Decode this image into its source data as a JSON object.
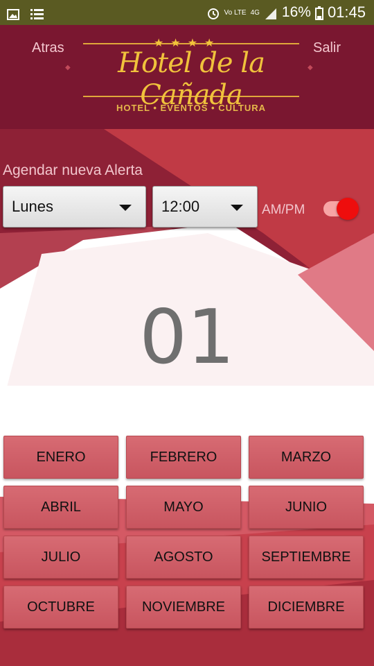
{
  "status_bar": {
    "battery": "16%",
    "time": "01:45",
    "network": "4G",
    "volte": "Vo LTE",
    "icons": [
      "image-icon",
      "list-icon",
      "alarm-icon",
      "signal-icon",
      "battery-icon"
    ]
  },
  "header": {
    "back_label": "Atras",
    "exit_label": "Salir",
    "logo_title": "Hotel de la Cañada",
    "logo_stars": "★★★★",
    "logo_subtitle": "HOTEL • EVENTOS • CULTURA"
  },
  "alert": {
    "title": "Agendar nueva Alerta",
    "day_value": "Lunes",
    "time_value": "12:00",
    "ampm_label": "AM/PM",
    "ampm_on": true
  },
  "selected_day": "01",
  "months": [
    "ENERO",
    "FEBRERO",
    "MARZO",
    "ABRIL",
    "MAYO",
    "JUNIO",
    "JULIO",
    "AGOSTO",
    "SEPTIEMBRE",
    "OCTUBRE",
    "NOVIEMBRE",
    "DICIEMBRE"
  ],
  "colors": {
    "header_bg": "#7a1730",
    "accent_red": "#ee0d0d",
    "month_button": "#d05f68",
    "status_bar": "#5a5a22"
  }
}
